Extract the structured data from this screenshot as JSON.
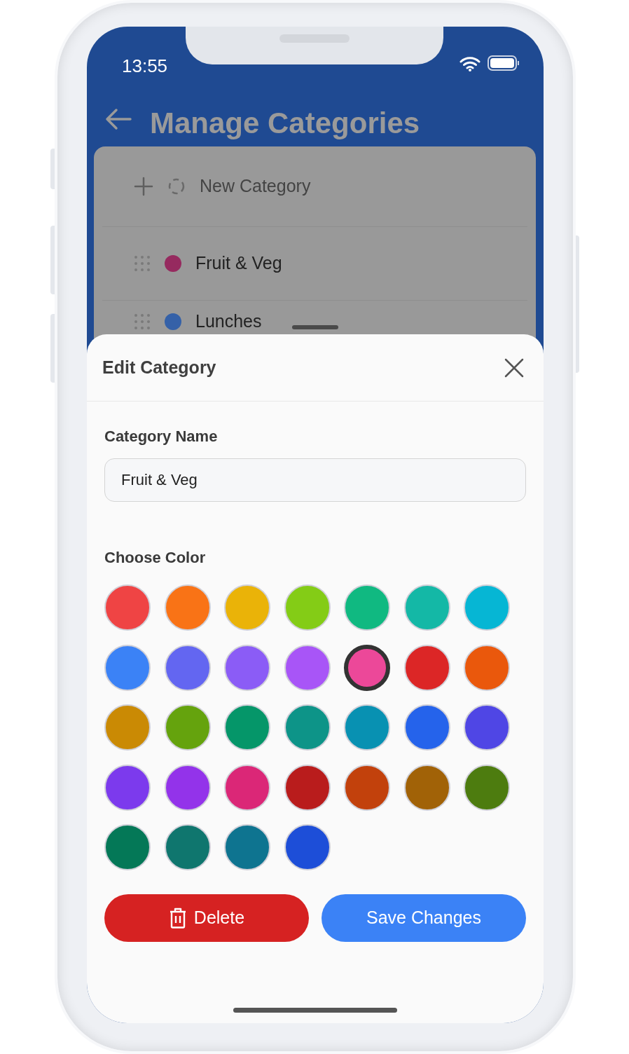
{
  "status_bar": {
    "time": "13:55"
  },
  "header": {
    "title": "Manage Categories"
  },
  "categories": [
    {
      "kind": "new",
      "name": "New Category"
    },
    {
      "kind": "category",
      "name": "Fruit & Veg",
      "color": "#962a5f"
    },
    {
      "kind": "category",
      "name": "Lunches",
      "color": "#3561a8"
    }
  ],
  "sheet": {
    "title": "Edit Category",
    "name_label": "Category Name",
    "name_value": "Fruit & Veg",
    "color_label": "Choose Color",
    "colors": [
      {
        "color": "#ef4444",
        "selected": false
      },
      {
        "color": "#f97316",
        "selected": false
      },
      {
        "color": "#eab308",
        "selected": false
      },
      {
        "color": "#84cc16",
        "selected": false
      },
      {
        "color": "#10b981",
        "selected": false
      },
      {
        "color": "#14b8a6",
        "selected": false
      },
      {
        "color": "#06b6d4",
        "selected": false
      },
      {
        "color": "#3b82f6",
        "selected": false
      },
      {
        "color": "#6366f1",
        "selected": false
      },
      {
        "color": "#8b5cf6",
        "selected": false
      },
      {
        "color": "#a855f7",
        "selected": false
      },
      {
        "color": "#ec4899",
        "selected": true
      },
      {
        "color": "#dc2626",
        "selected": false
      },
      {
        "color": "#ea580c",
        "selected": false
      },
      {
        "color": "#ca8a04",
        "selected": false
      },
      {
        "color": "#65a30d",
        "selected": false
      },
      {
        "color": "#059669",
        "selected": false
      },
      {
        "color": "#0d9488",
        "selected": false
      },
      {
        "color": "#0891b2",
        "selected": false
      },
      {
        "color": "#2563eb",
        "selected": false
      },
      {
        "color": "#4f46e5",
        "selected": false
      },
      {
        "color": "#7c3aed",
        "selected": false
      },
      {
        "color": "#9333ea",
        "selected": false
      },
      {
        "color": "#db2777",
        "selected": false
      },
      {
        "color": "#b91c1c",
        "selected": false
      },
      {
        "color": "#c2410c",
        "selected": false
      },
      {
        "color": "#a16207",
        "selected": false
      },
      {
        "color": "#4d7c0f",
        "selected": false
      },
      {
        "color": "#047857",
        "selected": false
      },
      {
        "color": "#0f766e",
        "selected": false
      },
      {
        "color": "#0e7490",
        "selected": false
      },
      {
        "color": "#1d4ed8",
        "selected": false
      }
    ],
    "delete_label": "Delete",
    "save_label": "Save Changes"
  }
}
